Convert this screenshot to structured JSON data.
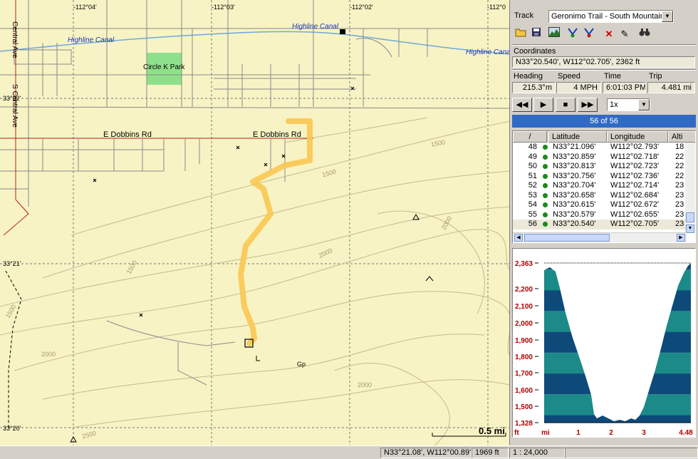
{
  "map": {
    "lon_labels": [
      "-112°04'",
      "-112°03'",
      "-112°02'",
      "-112°0"
    ],
    "lat_labels": [
      "33°22'",
      "33°21'",
      "33°20'"
    ],
    "canal_labels": [
      "Highline Canal",
      "Highline Canal",
      "Highline Canal"
    ],
    "park_label": "Circle K Park",
    "road_labels": [
      "E Dobbins Rd",
      "E Dobbins Rd"
    ],
    "street_labels": [
      "Central Ave",
      "S Central Ave"
    ],
    "contour_labels": [
      "1500",
      "1500",
      "2000",
      "2000",
      "1500",
      "1500",
      "2000",
      "2000",
      "2500"
    ],
    "gp_label": "Gp",
    "scale_label": "0.5 mi",
    "colors": {
      "background": "#f7f3c4",
      "track": "#f9c752",
      "canal": "#6fa8dc",
      "park": "#8fe08a",
      "road_major": "#b22222"
    }
  },
  "status": {
    "coords": "N33°21.08', W112°00.89'",
    "elevation": "1969 ft",
    "scale": "1 : 24,000"
  },
  "panel": {
    "track_label": "Track",
    "track_name": "Geronimo Trail - South Mountain",
    "toolbar_icons": [
      "open-folder-icon",
      "save-icon",
      "elevation-profile-icon",
      "begin-marker-icon",
      "end-marker-icon",
      "delete-icon",
      "edit-pencil-icon",
      "find-binoculars-icon"
    ],
    "coordinates_label": "Coordinates",
    "coordinates_value": "N33°20.540', W112°02.705', 2362 ft",
    "heading_label": "Heading",
    "speed_label": "Speed",
    "time_label": "Time",
    "trip_label": "Trip",
    "heading_value": "215.3°m",
    "speed_value": "4 MPH",
    "time_value": "6:01:03 PM",
    "trip_value": "4.481 mi",
    "playback": {
      "rewind": "◀◀",
      "play": "▶",
      "stop": "■",
      "forward": "▶▶",
      "speed": "1x"
    },
    "progress_text": "56 of 56",
    "progress_fraction": 1.0,
    "table": {
      "headers": [
        "/",
        "Latitude",
        "Longitude",
        "Alti"
      ],
      "rows": [
        {
          "n": "48",
          "lat": "N33°21.096'",
          "lon": "W112°02.793'",
          "alt": "18"
        },
        {
          "n": "49",
          "lat": "N33°20.859'",
          "lon": "W112°02.718'",
          "alt": "22"
        },
        {
          "n": "50",
          "lat": "N33°20.813'",
          "lon": "W112°02.723'",
          "alt": "22"
        },
        {
          "n": "51",
          "lat": "N33°20.756'",
          "lon": "W112°02.736'",
          "alt": "22"
        },
        {
          "n": "52",
          "lat": "N33°20.704'",
          "lon": "W112°02.714'",
          "alt": "23"
        },
        {
          "n": "53",
          "lat": "N33°20.658'",
          "lon": "W112°02.684'",
          "alt": "23"
        },
        {
          "n": "54",
          "lat": "N33°20.615'",
          "lon": "W112°02.672'",
          "alt": "23"
        },
        {
          "n": "55",
          "lat": "N33°20.579'",
          "lon": "W112°02.655'",
          "alt": "23"
        },
        {
          "n": "56",
          "lat": "N33°20.540'",
          "lon": "W112°02.705'",
          "alt": "23"
        }
      ],
      "selected_row": "56"
    },
    "profile": {
      "y_ticks": [
        "2,363",
        "2,200",
        "2,100",
        "2,000",
        "1,900",
        "1,800",
        "1,700",
        "1,600",
        "1,500",
        "1,328"
      ],
      "y_unit": "ft",
      "x_ticks": [
        "mi",
        "1",
        "2",
        "3",
        "4.48"
      ],
      "colors": {
        "band_dark": "#0d4a7a",
        "band_teal": "#1c8a88",
        "label": "#b00000"
      }
    }
  }
}
